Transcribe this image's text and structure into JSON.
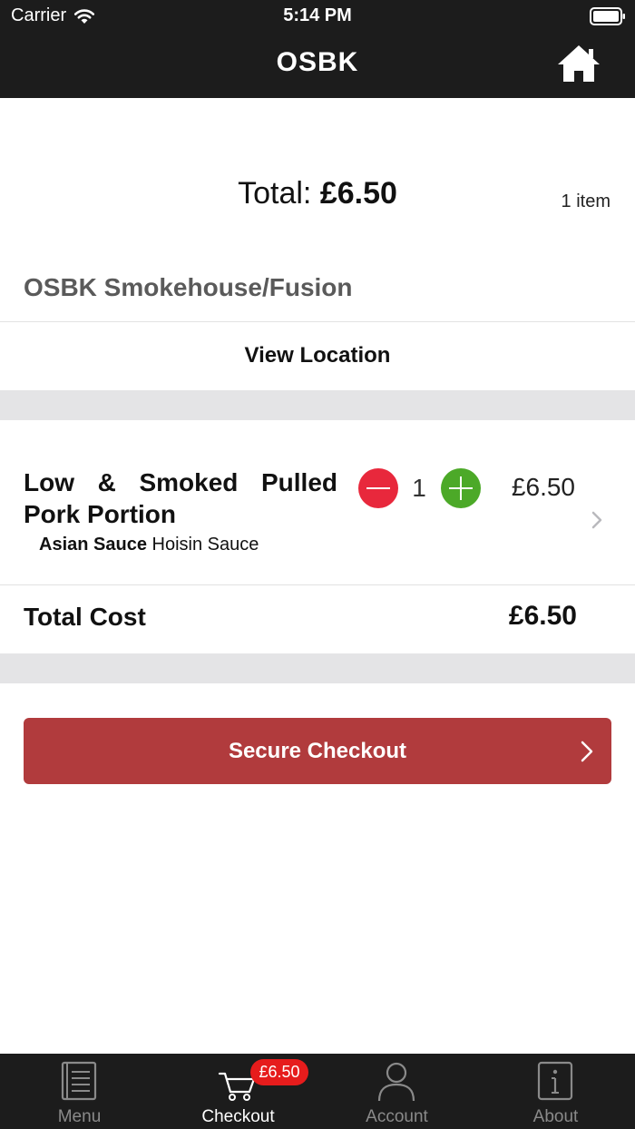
{
  "status_bar": {
    "carrier": "Carrier",
    "time": "5:14 PM"
  },
  "nav": {
    "title": "OSBK"
  },
  "summary": {
    "total_label": "Total:",
    "total_amount": "£6.50",
    "item_count": "1 item"
  },
  "store": {
    "name": "OSBK Smokehouse/Fusion",
    "view_location": "View Location"
  },
  "items": [
    {
      "name": "Low & Smoked Pulled Pork Portion",
      "modifier_label": "Asian Sauce",
      "modifier_value": "Hoisin Sauce",
      "quantity": "1",
      "price": "£6.50"
    }
  ],
  "totals": {
    "label": "Total Cost",
    "value": "£6.50"
  },
  "checkout": {
    "label": "Secure Checkout"
  },
  "tabbar": {
    "tabs": [
      {
        "label": "Menu",
        "icon": "menu-book-icon"
      },
      {
        "label": "Checkout",
        "icon": "cart-icon"
      },
      {
        "label": "Account",
        "icon": "person-icon"
      },
      {
        "label": "About",
        "icon": "info-icon"
      }
    ],
    "active": "Checkout",
    "cart_badge": "£6.50"
  },
  "colors": {
    "bar_background": "#1c1c1c",
    "checkout_button": "#b13b3d",
    "minus_button": "#e8283c",
    "plus_button": "#4ca928",
    "badge": "#e61c1c",
    "separator_band": "#e4e4e6"
  }
}
